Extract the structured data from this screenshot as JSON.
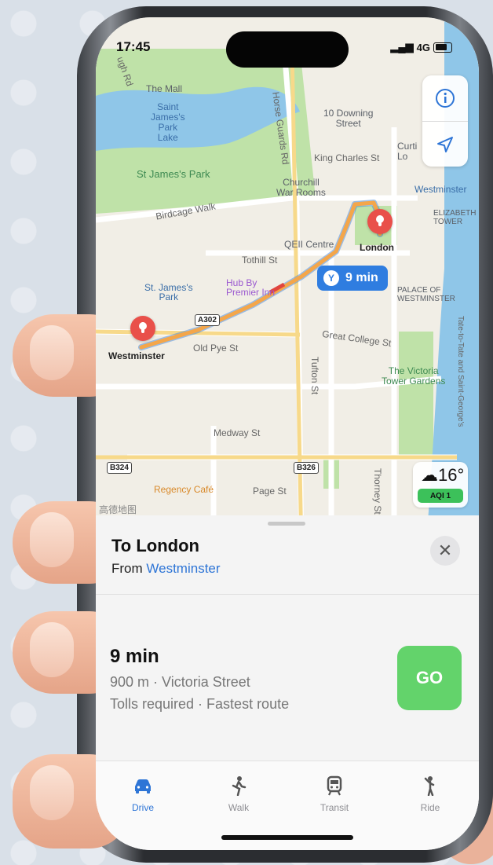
{
  "status_bar": {
    "time": "17:45",
    "signal": "4G"
  },
  "map": {
    "labels": {
      "upper_left_road": "ugh Rd",
      "the_mall": "The Mall",
      "saint_james_park_lake": "Saint\nJames's\nPark\nLake",
      "st_james_park": "St James's Park",
      "horse_guards": "Horse Guards Rd",
      "downing": "10 Downing\nStreet",
      "king_charles": "King Charles St",
      "churchill": "Churchill\nWar Rooms",
      "curtis": "Curti\nLo",
      "westminster_top": "Westminster",
      "birdcage": "Birdcage Walk",
      "elizabeth": "ELIZABETH\nTOWER",
      "qeii": "QEII Centre",
      "london_pin": "London",
      "tothill": "Tothill St",
      "st_james_park_station": "St. James's\nPark",
      "hub": "Hub By\nPremier Inn",
      "palace": "PALACE OF\nWESTMINSTER",
      "westminster_pin": "Westminster",
      "old_pye": "Old Pye St",
      "great_college": "Great College St",
      "tufton": "Tufton St",
      "victoria_gardens": "The Victoria\nTower Gardens",
      "medway": "Medway St",
      "regency": "Regency Café",
      "page_st": "Page St",
      "thorney": "Thorney St",
      "tate": "Tate-to-Tate and Saint-George's",
      "watermark": "高德地图"
    },
    "shields": {
      "a302": "A302",
      "b324": "B324",
      "b326": "B326"
    },
    "eta_label": "9 min",
    "weather": {
      "temp": "16°",
      "aqi": "AQI 1"
    }
  },
  "sheet": {
    "destination": "To London",
    "from_prefix": "From ",
    "from_place": "Westminster",
    "route_time": "9 min",
    "route_meta": "900 m · Victoria Street",
    "route_note": "Tolls required · Fastest route",
    "go_label": "GO"
  },
  "tabs": [
    {
      "label": "Drive",
      "icon": "car-icon"
    },
    {
      "label": "Walk",
      "icon": "walk-icon"
    },
    {
      "label": "Transit",
      "icon": "train-icon"
    },
    {
      "label": "Ride",
      "icon": "ride-icon"
    }
  ],
  "colors": {
    "accent": "#2e75d6",
    "go": "#63d36b",
    "pin": "#e9504a",
    "route": "#f4a64a"
  }
}
